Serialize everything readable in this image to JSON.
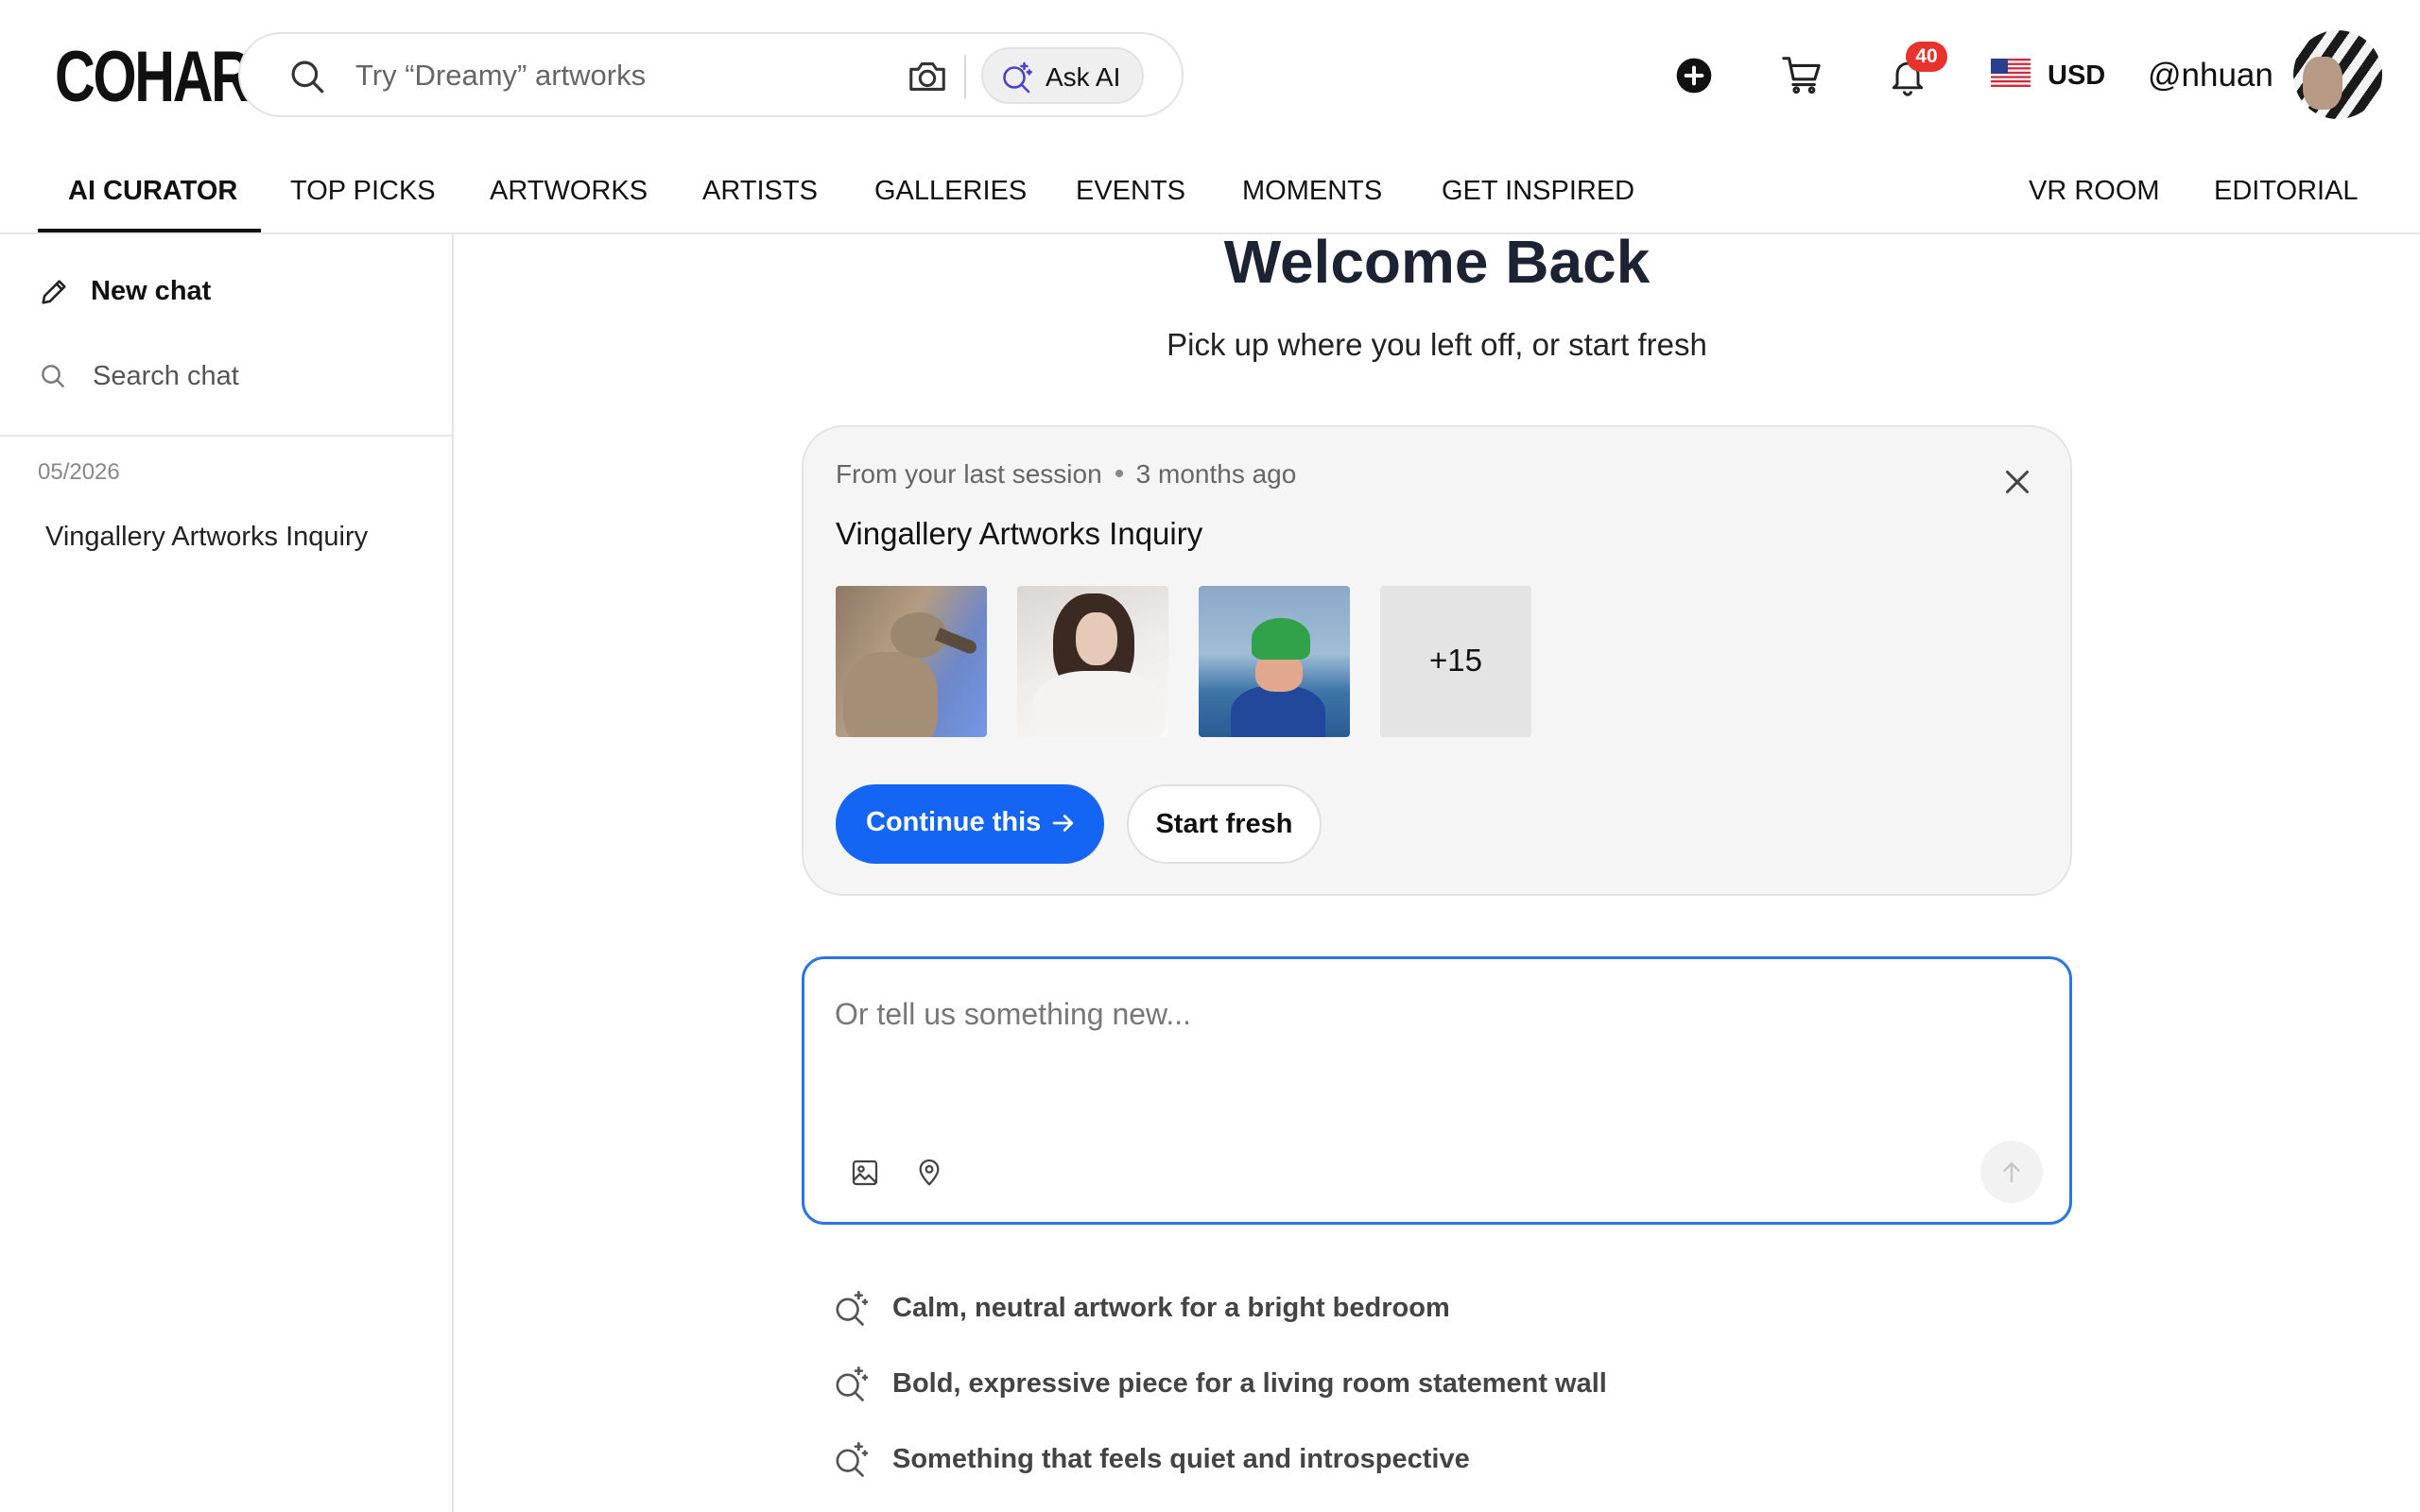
{
  "header": {
    "logo": "COHART",
    "search_placeholder": "Try “Dreamy” artworks",
    "ask_ai_label": "Ask AI",
    "notification_count": "40",
    "currency": "USD",
    "username": "@nhuan"
  },
  "nav": {
    "items": [
      {
        "label": "AI CURATOR",
        "active": true
      },
      {
        "label": "TOP PICKS"
      },
      {
        "label": "ARTWORKS"
      },
      {
        "label": "ARTISTS"
      },
      {
        "label": "GALLERIES"
      },
      {
        "label": "EVENTS"
      },
      {
        "label": "MOMENTS"
      },
      {
        "label": "GET INSPIRED"
      },
      {
        "label": "VR ROOM"
      },
      {
        "label": "EDITORIAL"
      }
    ]
  },
  "sidebar": {
    "new_chat": "New chat",
    "search_chat": "Search chat",
    "group_date": "05/2026",
    "chats": [
      "Vingallery Artworks Inquiry"
    ]
  },
  "main": {
    "title": "Welcome Back",
    "subtitle": "Pick up where you left off, or start fresh",
    "session": {
      "source": "From your last session",
      "age": "3 months ago",
      "title": "Vingallery Artworks Inquiry",
      "more_count": "+15",
      "continue_label": "Continue this",
      "fresh_label": "Start fresh"
    },
    "composer_placeholder": "Or tell us something new...",
    "suggestions": [
      "Calm, neutral artwork for a bright bedroom",
      "Bold, expressive piece for a living room statement wall",
      "Something that feels quiet and introspective"
    ]
  },
  "colors": {
    "primary": "#1565f5",
    "badge": "#e8322d",
    "focus_border": "#2a74e8",
    "title": "#1c2333"
  }
}
